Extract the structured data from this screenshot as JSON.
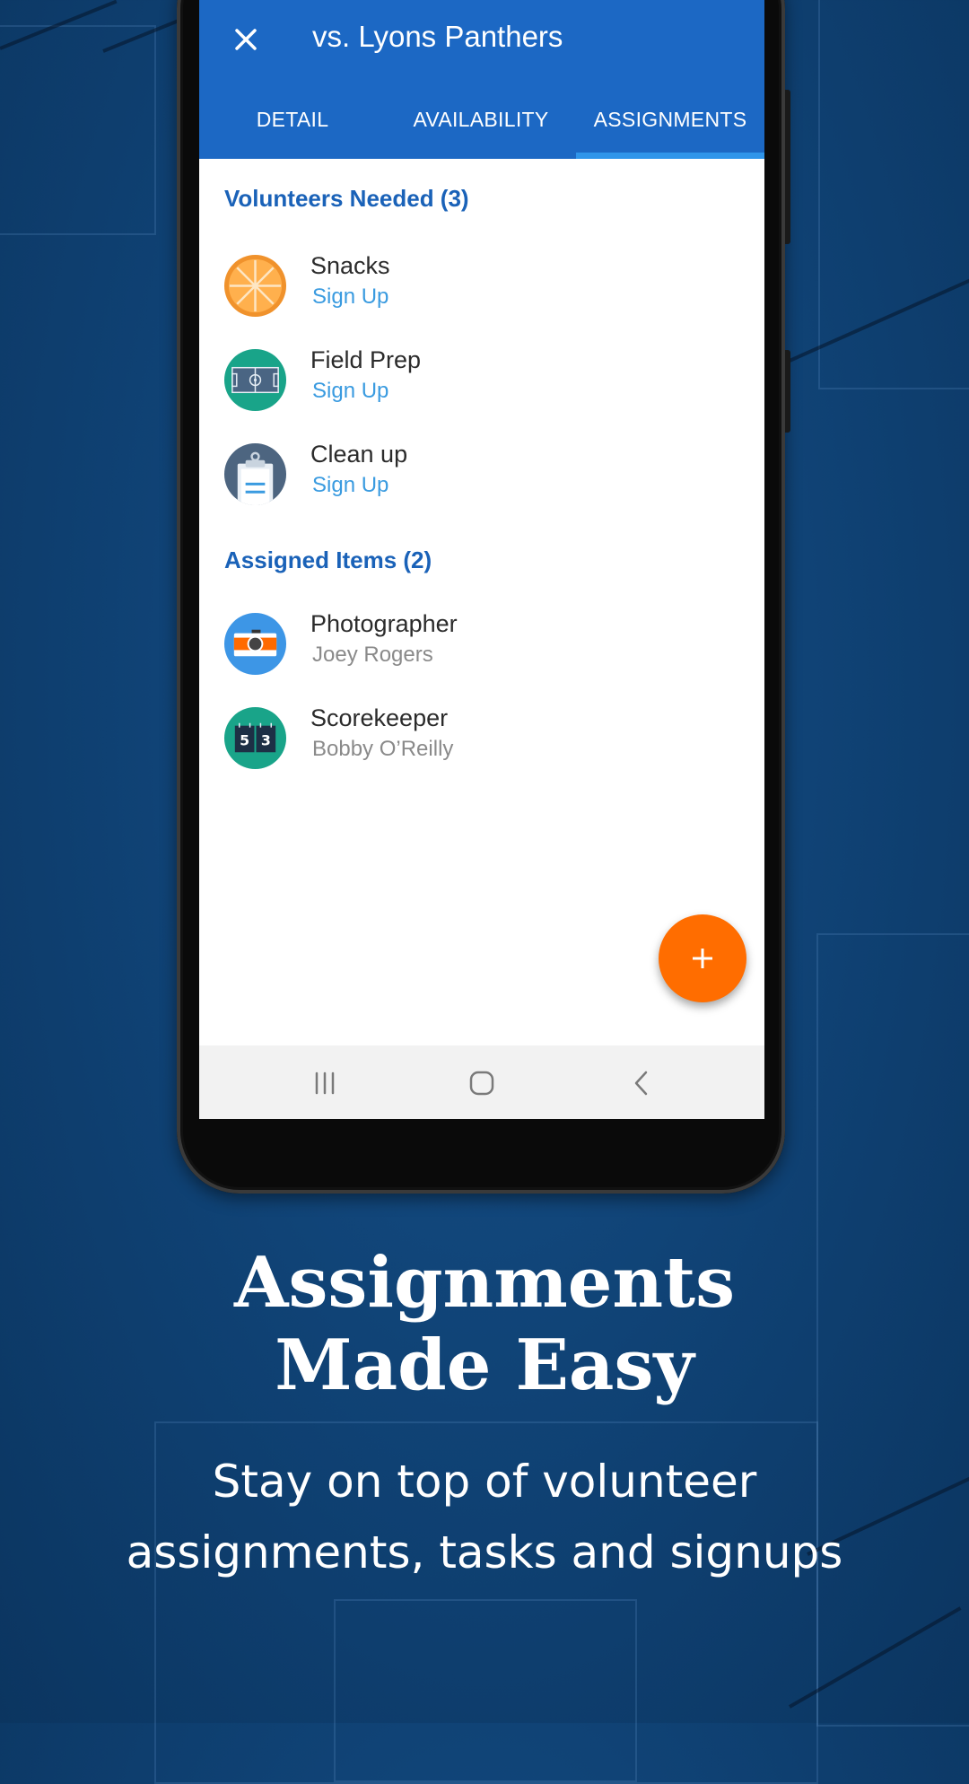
{
  "app_bar": {
    "title": "vs. Lyons Panthers",
    "close_icon": "close-icon"
  },
  "tabs": [
    {
      "label": "DETAIL",
      "active": false
    },
    {
      "label": "AVAILABILITY",
      "active": false
    },
    {
      "label": "ASSIGNMENTS",
      "active": true
    }
  ],
  "volunteers_needed": {
    "header": "Volunteers Needed (3)",
    "items": [
      {
        "name": "Snacks",
        "action": "Sign Up",
        "icon": "orange-slice-icon"
      },
      {
        "name": "Field Prep",
        "action": "Sign Up",
        "icon": "soccer-field-icon"
      },
      {
        "name": "Clean up",
        "action": "Sign Up",
        "icon": "clipboard-icon"
      }
    ]
  },
  "assigned_items": {
    "header": "Assigned Items (2)",
    "items": [
      {
        "name": "Photographer",
        "assignee": "Joey Rogers",
        "icon": "camera-icon"
      },
      {
        "name": "Scorekeeper",
        "assignee": "Bobby O’Reilly",
        "icon": "scoreboard-icon",
        "score_digits": [
          "5",
          "3"
        ]
      }
    ]
  },
  "fab": {
    "icon": "plus-icon"
  },
  "system_nav": {
    "recents": "recents-icon",
    "home": "home-icon",
    "back": "back-icon"
  },
  "promo": {
    "headline_line1": "Assignments",
    "headline_line2": "Made Easy",
    "subtitle_line1": "Stay on top of volunteer",
    "subtitle_line2": "assignments, tasks and signups"
  },
  "colors": {
    "app_bar": "#1c68c4",
    "tab_indicator": "#2f95ea",
    "section_header": "#1a62b8",
    "link": "#3a9be0",
    "fab": "#ff6d00",
    "background": "#0f4173"
  }
}
